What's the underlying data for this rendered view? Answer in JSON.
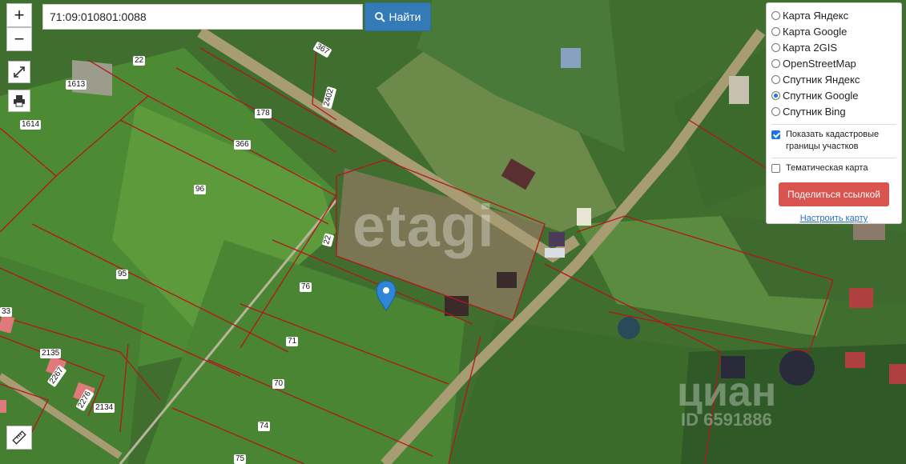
{
  "search": {
    "value": "71:09:010801:0088",
    "button_label": "Найти"
  },
  "zoom": {
    "in_label": "+",
    "out_label": "−"
  },
  "tools": {
    "fullscreen": "expand-icon",
    "print": "print-icon",
    "ruler": "ruler-icon"
  },
  "layers": {
    "items": [
      {
        "label": "Карта Яндекс",
        "selected": false
      },
      {
        "label": "Карта Google",
        "selected": false
      },
      {
        "label": "Карта 2GIS",
        "selected": false
      },
      {
        "label": "OpenStreetMap",
        "selected": false
      },
      {
        "label": "Спутник Яндекс",
        "selected": false
      },
      {
        "label": "Спутник Google",
        "selected": true
      },
      {
        "label": "Спутник Bing",
        "selected": false
      }
    ],
    "cadastral_label": "Показать кадастровые границы участков",
    "cadastral_checked": true,
    "thematic_label": "Тематическая карта",
    "thematic_checked": false,
    "share_label": "Поделиться ссылкой",
    "configure_label": "Настроить карту"
  },
  "plot_labels": {
    "p22a": "22",
    "p1613": "1613",
    "p1614": "1614",
    "p178": "178",
    "p367": "367",
    "p2402": "2402",
    "p366": "366",
    "p96": "96",
    "p95": "95",
    "p22b": "22",
    "p76": "76",
    "p71": "71",
    "p70": "70",
    "p74": "74",
    "p75": "75",
    "p2135": "2135",
    "p2267": "2267",
    "p2134": "2134",
    "p2276": "2276",
    "p33": "33"
  },
  "watermarks": {
    "etagi": "etagi",
    "cian": "циан",
    "cian_id": "ID 6591886"
  },
  "colors": {
    "accent": "#337ab7",
    "share": "#d9534f",
    "boundary": "#b3161b",
    "marker": "#2f86d6"
  }
}
